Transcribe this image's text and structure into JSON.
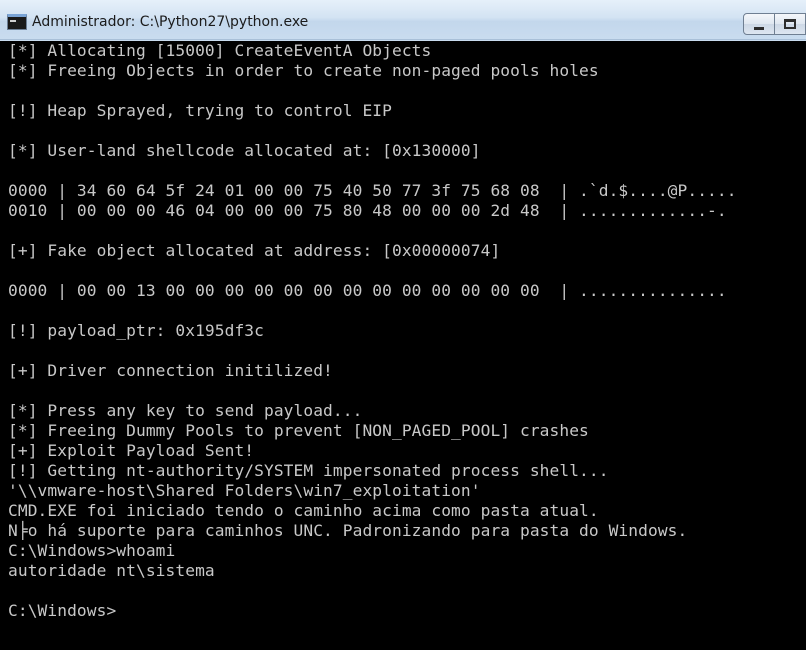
{
  "window": {
    "title": "Administrador: C:\\Python27\\python.exe",
    "controls": {
      "minimize_label": "",
      "restore_label": ""
    },
    "icon": "console-icon"
  },
  "console": {
    "foreground": "#c8c8c8",
    "background": "#000000",
    "lines": [
      "[*] Allocating [15000] CreateEventA Objects",
      "[*] Freeing Objects in order to create non-paged pools holes",
      "",
      "[!] Heap Sprayed, trying to control EIP",
      "",
      "[*] User-land shellcode allocated at: [0x130000]",
      "",
      "0000 | 34 60 64 5f 24 01 00 00 75 40 50 77 3f 75 68 08  | .`d.$....@P.....",
      "0010 | 00 00 00 46 04 00 00 00 75 80 48 00 00 00 2d 48  | .............-.",
      "",
      "[+] Fake object allocated at address: [0x00000074]",
      "",
      "0000 | 00 00 13 00 00 00 00 00 00 00 00 00 00 00 00 00  | ...............",
      "",
      "[!] payload_ptr: 0x195df3c",
      "",
      "[+] Driver connection initilized!",
      "",
      "[*] Press any key to send payload...",
      "[*] Freeing Dummy Pools to prevent [NON_PAGED_POOL] crashes",
      "[+] Exploit Payload Sent!",
      "[!] Getting nt-authority/SYSTEM impersonated process shell...",
      "'\\\\vmware-host\\Shared Folders\\win7_exploitation'",
      "CMD.EXE foi iniciado tendo o caminho acima como pasta atual.",
      "N╞o há suporte para caminhos UNC. Padronizando para pasta do Windows.",
      "C:\\Windows>whoami",
      "autoridade nt\\sistema",
      "",
      "C:\\Windows>"
    ]
  }
}
